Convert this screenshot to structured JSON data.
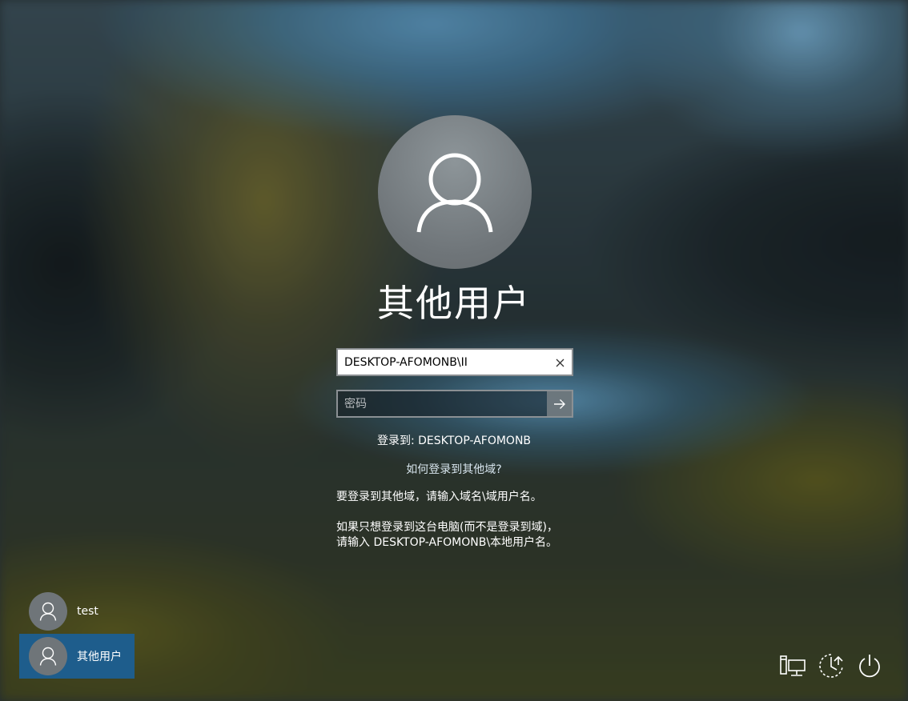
{
  "login": {
    "user_title": "其他用户",
    "username_value": "DESKTOP-AFOMONB\\II",
    "password_placeholder": "密码",
    "signin_to": "登录到: DESKTOP-AFOMONB",
    "how_to_link": "如何登录到其他域?",
    "info_domain": "要登录到其他域，请输入域名\\域用户名。",
    "info_local": "如果只想登录到这台电脑(而不是登录到域)，请输入 DESKTOP-AFOMONB\\本地用户名。"
  },
  "users": [
    {
      "name": "test",
      "selected": false
    },
    {
      "name": "其他用户",
      "selected": true
    }
  ],
  "system_buttons": [
    {
      "icon": "network-icon"
    },
    {
      "icon": "ease-of-access-icon"
    },
    {
      "icon": "power-icon"
    }
  ],
  "colors": {
    "selected_user": "#1e5d8c",
    "avatar": "#6f7579"
  }
}
